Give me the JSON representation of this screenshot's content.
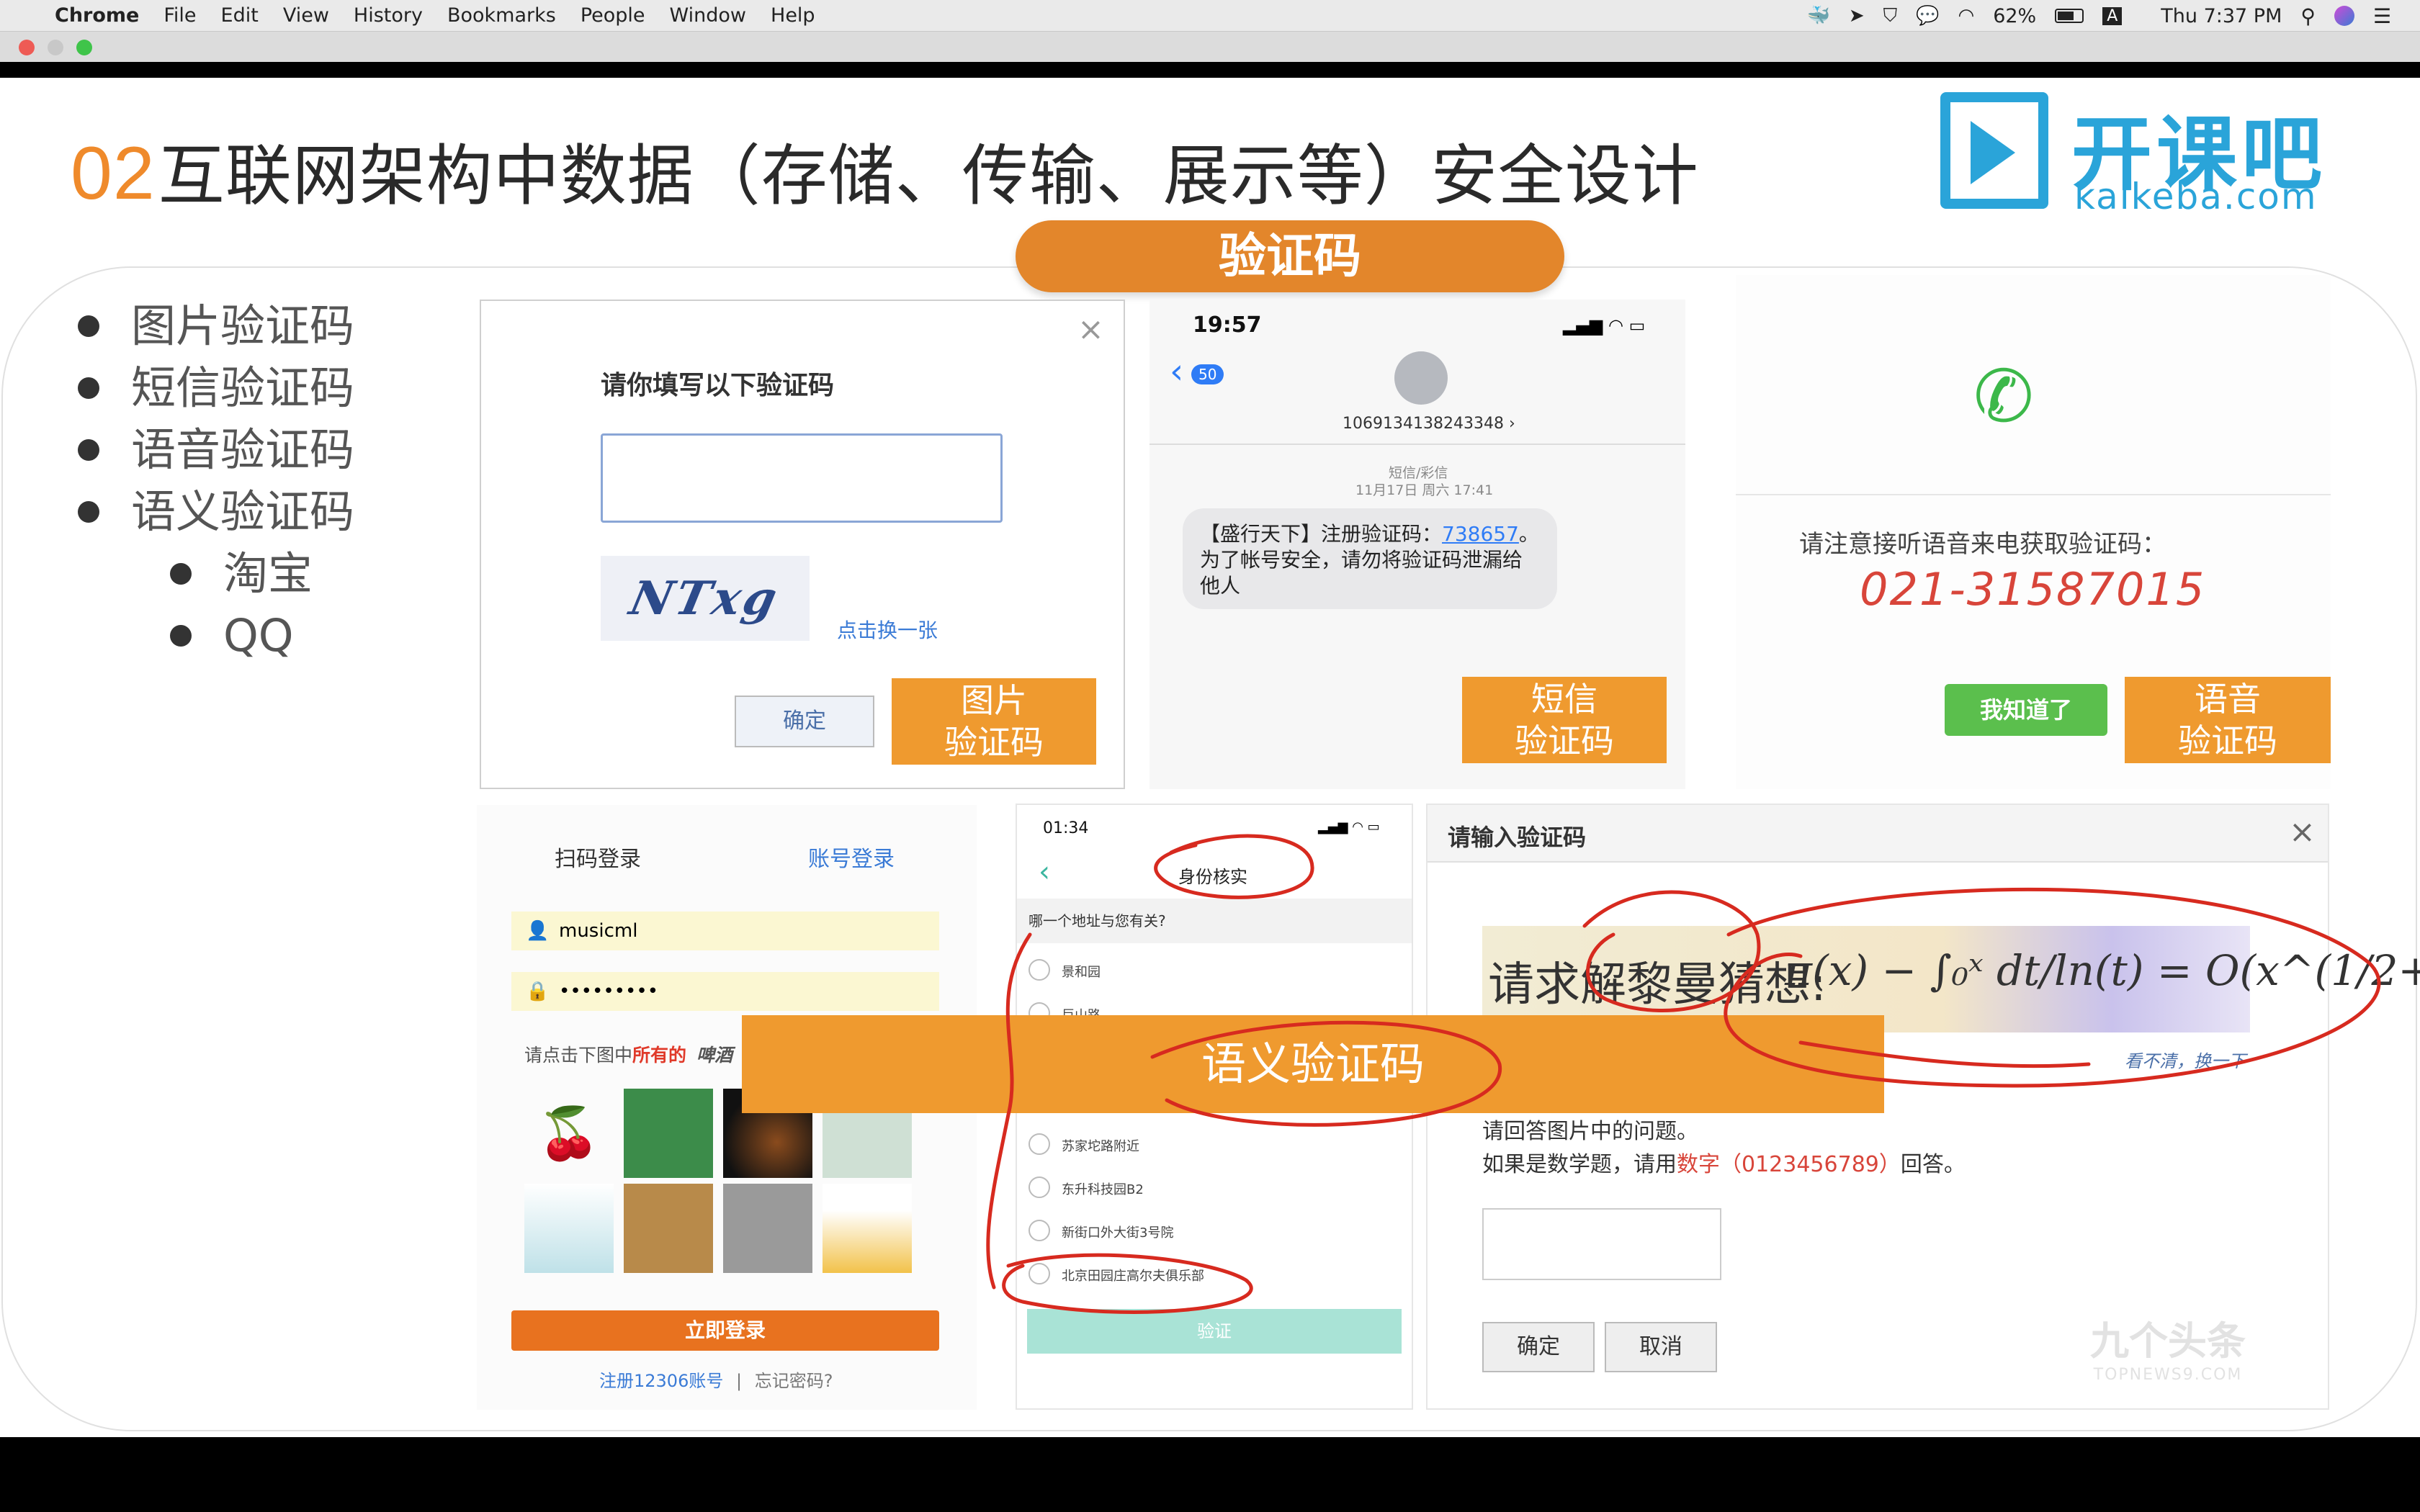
{
  "menubar": {
    "app": "Chrome",
    "items": [
      "File",
      "Edit",
      "View",
      "History",
      "Bookmarks",
      "People",
      "Window",
      "Help"
    ],
    "battery": "62%",
    "input_method": "A",
    "clock": "Thu 7:37 PM"
  },
  "slide": {
    "number": "02",
    "title": "互联网架构中数据（存储、传输、展示等）安全设计",
    "logo_cn": "开课吧",
    "logo_en": "kaikeba.com",
    "section_pill": "验证码",
    "bullets": [
      "图片验证码",
      "短信验证码",
      "语音验证码",
      "语义验证码"
    ],
    "sub_bullets": [
      "淘宝",
      "QQ"
    ]
  },
  "image_captcha": {
    "prompt": "请你填写以下验证码",
    "captcha_text": "NTxg",
    "refresh": "点击换一张",
    "confirm": "确定",
    "tag_line1": "图片",
    "tag_line2": "验证码"
  },
  "sms": {
    "time": "19:57",
    "back_count": "50",
    "sender": "1069134138243348 ›",
    "meta1": "短信/彩信",
    "meta2": "11月17日 周六 17:41",
    "msg_a": "【盛行天下】注册验证码：",
    "msg_code": "738657",
    "msg_b": "。为了帐号安全，请勿将验证码泄漏给他人",
    "tag_line1": "短信",
    "tag_line2": "验证码"
  },
  "voice": {
    "notice": "请注意接听语音来电获取验证码：",
    "number": "021-31587015",
    "ok": "我知道了",
    "tag_line1": "语音",
    "tag_line2": "验证码"
  },
  "taobao": {
    "tab_qr": "扫码登录",
    "tab_account": "账号登录",
    "username": "musicml",
    "password": "•••••••••",
    "instruction_a": "请点击下图中",
    "instruction_b": "所有的",
    "instruction_c": "啤酒",
    "login": "立即登录",
    "register": "注册12306账号",
    "separator": "|",
    "forgot": "忘记密码?"
  },
  "qq": {
    "time": "01:34",
    "title": "身份核实",
    "question": "哪一个地址与您有关?",
    "options": [
      "景和园",
      "巨山路",
      "苏家坨路附近",
      "东升科技园B2",
      "新街口外大街3号院",
      "北京田园庄高尔夫俱乐部"
    ],
    "verify": "验证"
  },
  "semantic_overlay": "语义验证码",
  "math": {
    "header": "请输入验证码",
    "close": "×",
    "question_text": "请求解黎曼猜想:",
    "change": "看不清，换一下",
    "instr1": "请回答图片中的问题。",
    "instr2a": "如果是数学题，请用",
    "instr2b": "数字（0123456789）",
    "instr2c": "回答。",
    "ok": "确定",
    "cancel": "取消",
    "watermark_cn": "九个头条",
    "watermark_en": "TOPNEWS9.COM"
  }
}
